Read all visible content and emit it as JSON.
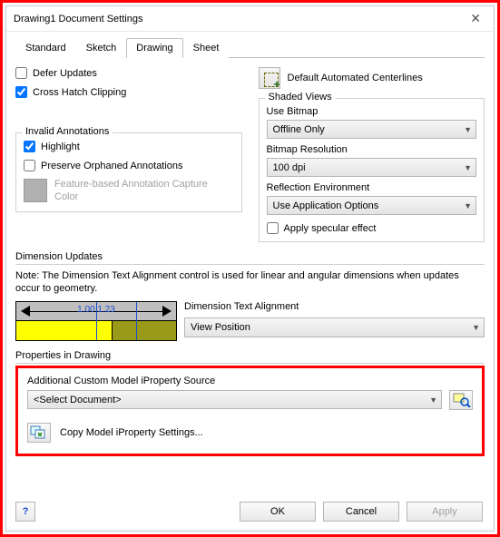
{
  "window": {
    "title": "Drawing1 Document Settings"
  },
  "tabs": [
    "Standard",
    "Sketch",
    "Drawing",
    "Sheet"
  ],
  "defer_updates": "Defer Updates",
  "cross_hatch": "Cross Hatch Clipping",
  "invalid_annotations": {
    "title": "Invalid Annotations",
    "highlight": "Highlight",
    "preserve": "Preserve Orphaned Annotations",
    "feature_color": "Feature-based Annotation Capture Color"
  },
  "centerlines": "Default Automated Centerlines",
  "shaded_views": {
    "title": "Shaded Views",
    "use_bitmap_label": "Use Bitmap",
    "use_bitmap_value": "Offline Only",
    "bitmap_res_label": "Bitmap Resolution",
    "bitmap_res_value": "100 dpi",
    "refl_env_label": "Reflection Environment",
    "refl_env_value": "Use Application Options",
    "specular": "Apply specular effect"
  },
  "dim_updates": {
    "title": "Dimension Updates",
    "note": "Note: The Dimension Text Alignment control is used for linear and angular dimensions when updates occur to geometry.",
    "preview_text": "1.00 1.23",
    "align_label": "Dimension Text Alignment",
    "align_value": "View Position"
  },
  "props": {
    "title": "Properties in Drawing",
    "source_label": "Additional Custom Model iProperty Source",
    "source_value": "<Select Document>",
    "copy_label": "Copy Model iProperty Settings..."
  },
  "buttons": {
    "ok": "OK",
    "cancel": "Cancel",
    "apply": "Apply",
    "help": "?"
  }
}
